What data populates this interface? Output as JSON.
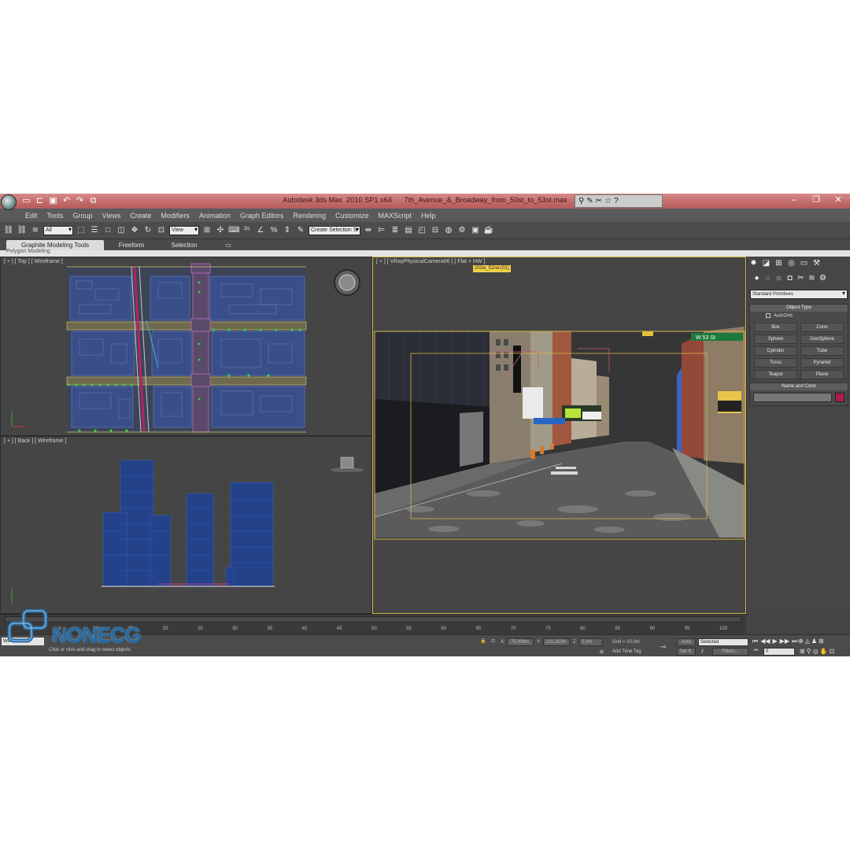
{
  "window": {
    "app_title": "Autodesk 3ds Max  2010 SP1 x64",
    "file_name": "7th_Avenue_&_Broadway_from_50st_to_53st.max"
  },
  "menu": [
    "Edit",
    "Tools",
    "Group",
    "Views",
    "Create",
    "Modifiers",
    "Animation",
    "Graph Editors",
    "Rendering",
    "Customize",
    "MAXScript",
    "Help"
  ],
  "toolbar": {
    "selection_filter": "All",
    "ref_coord": "View",
    "named_selection": "Create Selection S"
  },
  "ribbon": {
    "tabs": [
      "Graphite Modeling Tools",
      "Freeform",
      "Selection"
    ],
    "sub_label": "Polygon Modeling"
  },
  "viewports": {
    "top": {
      "label": "[ + ] [ Top ] [ Wireframe ]"
    },
    "back": {
      "label": "[ + ] [ Back ] [ Wireframe ]"
    },
    "camera": {
      "label": "[ + ] [ VRayPhysicalCamera06 ] [ Flat + HW ]",
      "tooltip": "201w_52nd-(01)",
      "street_sign": "W 53  St"
    }
  },
  "command_panel": {
    "category": "Standard Primitives",
    "object_type_title": "Object Type",
    "autogrid": "AutoGrid",
    "objects": [
      "Box",
      "Cone",
      "Sphere",
      "GeoSphere",
      "Cylinder",
      "Tube",
      "Torus",
      "Pyramid",
      "Teapot",
      "Plane"
    ],
    "name_color_title": "Name and Color",
    "color": "#aa1f4a"
  },
  "timeline": {
    "ticks": [
      "0",
      "5",
      "10",
      "15",
      "20",
      "25",
      "30",
      "35",
      "40",
      "45",
      "50",
      "55",
      "60",
      "65",
      "70",
      "75",
      "80",
      "85",
      "90",
      "95",
      "100"
    ]
  },
  "status": {
    "welcome": "Welcome t",
    "prompt": "Click or click-and-drag to select objects",
    "x_label": "X:",
    "x_value": "-75,939m",
    "y_label": "Y:",
    "y_value": "233,253m",
    "z_label": "Z:",
    "z_value": "0,0m",
    "grid": "Grid = 10,0m",
    "add_time_tag": "Add Time Tag",
    "auto_key": "Auto",
    "set_key": "Set K.",
    "key_filter": "Selected",
    "filters": "Filters...",
    "frame": "0"
  },
  "watermark": {
    "text": "NONECG"
  }
}
